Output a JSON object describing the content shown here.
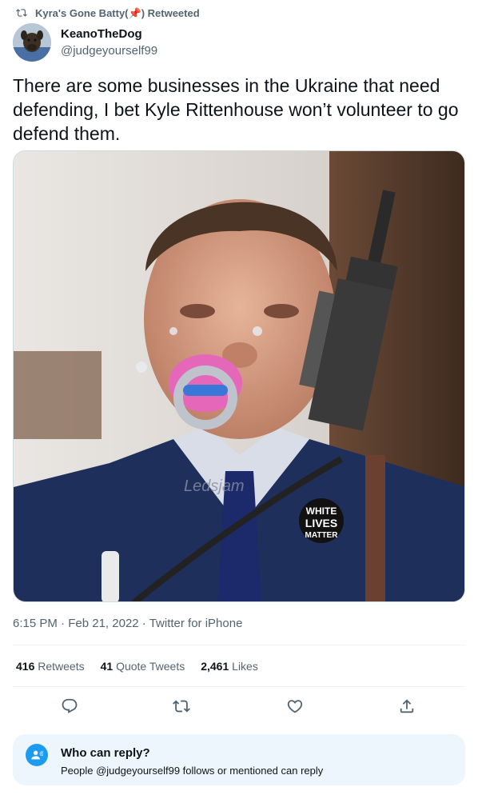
{
  "retweet": {
    "label": "Kyra's Gone Batty(📌) Retweeted"
  },
  "author": {
    "name": "KeanoTheDog",
    "handle": "@judgeyourself99"
  },
  "tweet": {
    "text": "There are some businesses in the Ukraine that need defending, I bet Kyle Rittenhouse won’t volunteer to go defend them."
  },
  "media": {
    "watermark": "Ledsjam",
    "badge_lines": [
      "WHITE",
      "LIVES",
      "MATTER"
    ]
  },
  "meta": {
    "time": "6:15 PM",
    "date": "Feb 21, 2022",
    "source": "Twitter for iPhone"
  },
  "stats": {
    "retweets_count": "416",
    "retweets_label": "Retweets",
    "quotes_count": "41",
    "quotes_label": "Quote Tweets",
    "likes_count": "2,461",
    "likes_label": "Likes"
  },
  "actions": [
    "reply-icon",
    "retweet-icon",
    "like-icon",
    "share-icon"
  ],
  "who_can_reply": {
    "title": "Who can reply?",
    "subtitle": "People @judgeyourself99 follows or mentioned can reply"
  },
  "colors": {
    "accent": "#1d9bf0",
    "text": "#0f1419",
    "muted": "#536471",
    "box": "#eef6fd"
  }
}
